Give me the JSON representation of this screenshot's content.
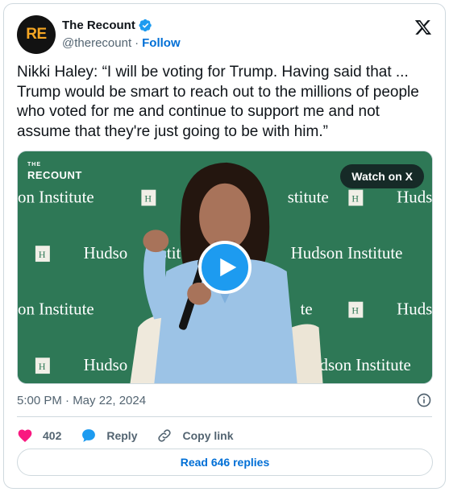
{
  "author": {
    "display_name": "The Recount",
    "handle": "@therecount",
    "follow_label": "Follow",
    "avatar_text": "RE",
    "verified": true
  },
  "tweet": {
    "text": "Nikki Haley: “I will be voting for Trump. Having said that ... Trump would be smart to reach out to the millions of people who voted for me and continue to support me and not assume that they're just going to be with him.”",
    "timestamp": "5:00 PM · May 22, 2024"
  },
  "media": {
    "watermark_small": "THE",
    "watermark": "RECOUNT",
    "watch_label": "Watch on X",
    "backdrop_texts": [
      "on Institute",
      "H",
      "stitute",
      "H",
      "Huds",
      "H",
      "Hudso",
      "Institute",
      "Hudson Institute",
      "on Institute",
      "te",
      "H",
      "Huds",
      "H",
      "Hudso",
      "dson Institute"
    ]
  },
  "actions": {
    "like_count": "402",
    "reply_label": "Reply",
    "copy_label": "Copy link",
    "read_replies_label": "Read 646 replies"
  },
  "colors": {
    "accent": "#1d9bf0",
    "link": "#006fd6",
    "like": "#f91880",
    "backdrop": "#2f7a5a"
  }
}
